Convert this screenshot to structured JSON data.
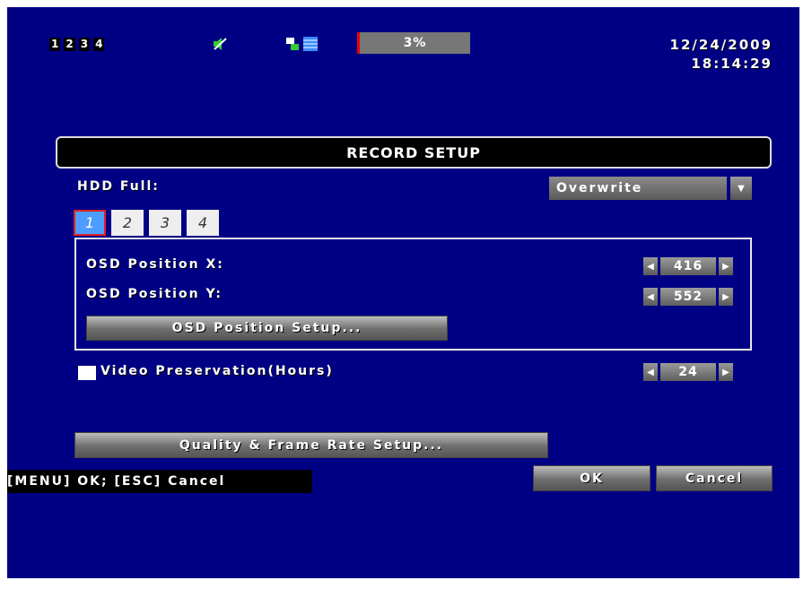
{
  "status": {
    "channels": [
      "1",
      "2",
      "3",
      "4"
    ],
    "hdd_usage": "3%",
    "date": "12/24/2009",
    "time": "18:14:29",
    "icons": [
      "speaker-mute-icon",
      "network-icon"
    ]
  },
  "dialog": {
    "title": "RECORD SETUP",
    "hdd_full_label": "HDD Full:",
    "hdd_full_value": "Overwrite",
    "channel_tabs": [
      "1",
      "2",
      "3",
      "4"
    ],
    "active_tab": "1",
    "osd_x_label": "OSD Position X:",
    "osd_x_value": "416",
    "osd_y_label": "OSD Position Y:",
    "osd_y_value": "552",
    "osd_setup_button": "OSD Position Setup...",
    "video_preservation_label": "Video Preservation(Hours)",
    "video_preservation_checked": false,
    "video_preservation_value": "24",
    "quality_button": "Quality & Frame Rate Setup...",
    "hint": "[MENU] OK; [ESC] Cancel",
    "ok_button": "OK",
    "cancel_button": "Cancel"
  },
  "colors": {
    "background": "#000085",
    "active_tab": "#4d9cff",
    "active_tab_border": "#e02020"
  }
}
